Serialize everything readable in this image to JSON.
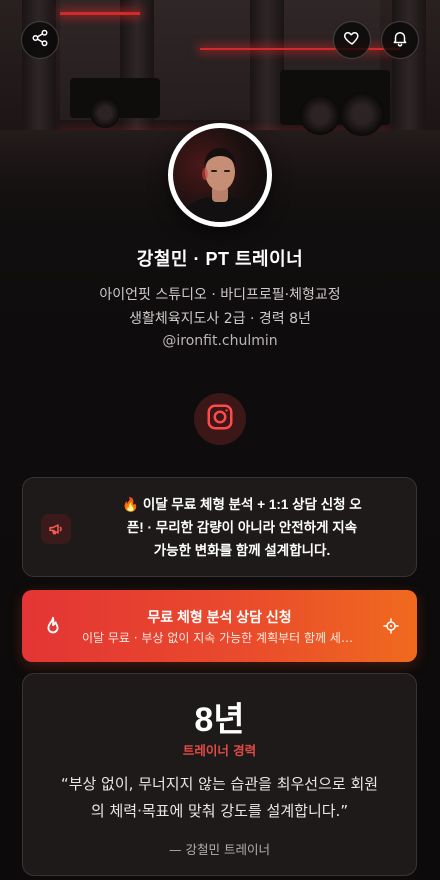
{
  "header": {
    "share_icon": "share-icon",
    "like_icon": "heart-icon",
    "notify_icon": "bell-icon"
  },
  "profile": {
    "name": "강철민 · PT 트레이너",
    "studio_line": "아이언핏 스튜디오 · 바디프로필·체형교정",
    "cert_line": "생활체육지도사 2급 · 경력 8년",
    "handle": "@ironfit.chulmin"
  },
  "social": {
    "instagram_icon": "instagram-icon"
  },
  "notice": {
    "icon": "megaphone-icon",
    "line1": "🔥 이달 무료 체형 분석 + 1:1 상담 신청 오",
    "line2": "픈! · 무리한 감량이 아니라 안전하게 지속",
    "line3": "가능한 변화를 함께 설계합니다."
  },
  "cta": {
    "title": "무료 체형 분석 상담 신청",
    "description": "이달 무료 · 부상 없이 지속 가능한 계획부터 함께 세워요",
    "left_icon": "fire-icon",
    "right_icon": "crosshair-icon"
  },
  "experience": {
    "years": "8년",
    "label": "트레이너 경력",
    "quote_line1": "“부상 없이, 무너지지 않는 습관을 최우선으로 회원",
    "quote_line2": "의 체력·목표에 맞춰 강도를 설계합니다.”",
    "author": "— 강철민 트레이너"
  },
  "colors": {
    "accent": "#e24a44",
    "cta_start": "#e33535",
    "cta_end": "#f06a1e",
    "background": "#0d0b0b",
    "card": "#1e1a1a"
  }
}
